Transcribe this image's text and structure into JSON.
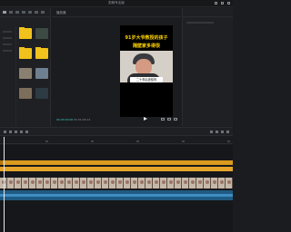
{
  "window": {
    "title": "剪映专业版"
  },
  "media": {
    "items": [
      {
        "type": "folder",
        "caption": ""
      },
      {
        "type": "video",
        "caption": ""
      },
      {
        "type": "folder",
        "caption": ""
      },
      {
        "type": "folder",
        "caption": ""
      },
      {
        "type": "video",
        "caption": ""
      },
      {
        "type": "video",
        "caption": ""
      },
      {
        "type": "video",
        "caption": ""
      },
      {
        "type": "video",
        "caption": ""
      }
    ]
  },
  "player": {
    "header": "播放器",
    "overlay_line1": "91岁大爷教授的孩子",
    "overlay_line2": "隔壁家多得很",
    "caption": "二十年后还给你",
    "current_time": "00:00:00:00",
    "total_time": "00:01:06:12"
  },
  "colors": {
    "accent": "#3ed0c9",
    "text_track": "#d99a1e",
    "audio_track": "#1f5a83",
    "folder": "#f1c21b",
    "overlay_text": "#ffd400"
  }
}
